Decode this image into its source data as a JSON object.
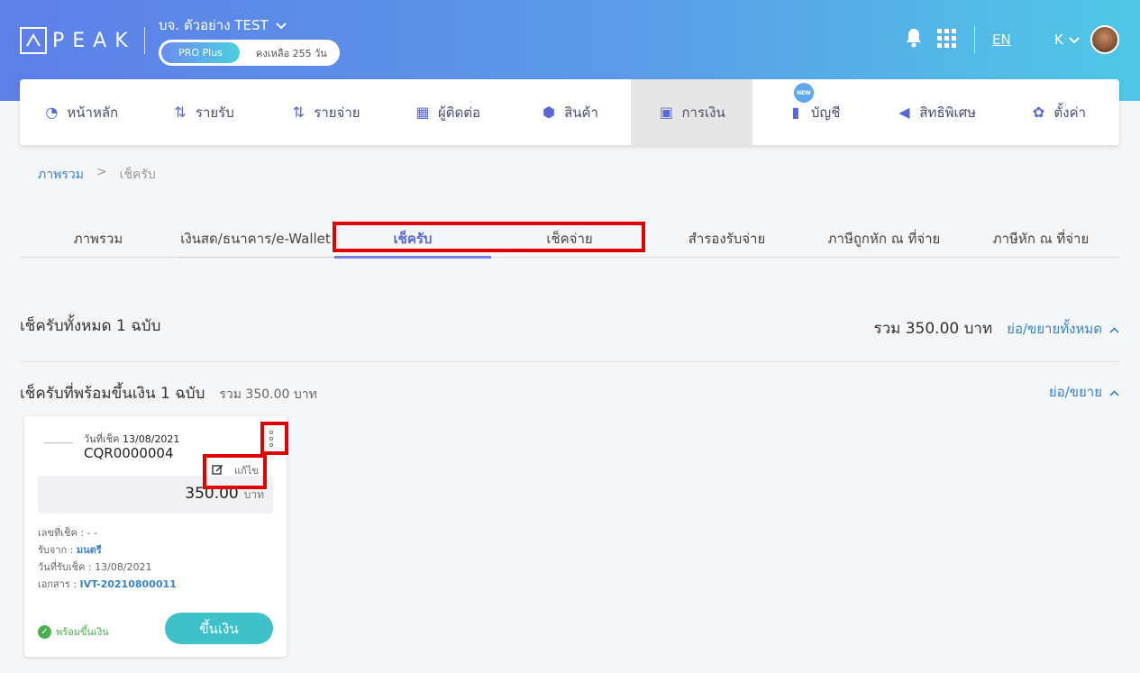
{
  "header": {
    "logo_text": "PEAK",
    "company": "บจ. ตัวอย่าง TEST",
    "plan": "PRO Plus",
    "plan_days": "คงเหลือ 255 วัน",
    "lang": "EN",
    "user_initial": "K"
  },
  "nav": [
    {
      "label": "หน้าหลัก",
      "icon": "dashboard-icon",
      "glyph": "◔"
    },
    {
      "label": "รายรับ",
      "icon": "income-icon",
      "glyph": "⇅"
    },
    {
      "label": "รายจ่าย",
      "icon": "expense-icon",
      "glyph": "⇅"
    },
    {
      "label": "ผู้ติดต่อ",
      "icon": "contacts-icon",
      "glyph": "▦"
    },
    {
      "label": "สินค้า",
      "icon": "product-box-icon",
      "glyph": "⬢"
    },
    {
      "label": "การเงิน",
      "icon": "money-icon",
      "glyph": "▣"
    },
    {
      "label": "บัญชี",
      "icon": "accounting-book-icon",
      "glyph": "▮"
    },
    {
      "label": "สิทธิพิเศษ",
      "icon": "megaphone-icon",
      "glyph": "◀"
    },
    {
      "label": "ตั้งค่า",
      "icon": "gear-icon",
      "glyph": "✿"
    }
  ],
  "nav_new_badge": "NEW",
  "breadcrumb": {
    "root": "ภาพรวม",
    "sep": ">",
    "current": "เช็ครับ"
  },
  "tabs": [
    "ภาพรวม",
    "เงินสด/ธนาคาร/e-Wallet",
    "เช็ครับ",
    "เช็คจ่าย",
    "สำรองรับจ่าย",
    "ภาษีถูกหัก ณ ที่จ่าย",
    "ภาษีหัก ณ ที่จ่าย"
  ],
  "summary": {
    "title": "เช็ครับทั้งหมด 1 ฉบับ",
    "total": "รวม 350.00 บาท",
    "toggle_all": "ย่อ/ขยายทั้งหมด"
  },
  "group": {
    "title": "เช็ครับที่พร้อมขึ้นเงิน 1 ฉบับ",
    "subtotal": "รวม 350.00 บาท",
    "toggle": "ย่อ/ขยาย"
  },
  "card": {
    "date_label": "วันที่เช็ค",
    "date": "13/08/2021",
    "number": "CQR0000004",
    "edit": "แก้ไข",
    "amount": "350.00",
    "currency": "บาท",
    "cheque_no": "เลขที่เช็ค : - -",
    "from_label": "รับจาก : ",
    "from": "มนตรี",
    "received_date": "วันที่รับเช็ค : 13/08/2021",
    "doc_label": "เอกสาร : ",
    "doc": "IVT-20210800011",
    "status": "พร้อมขึ้นเงิน",
    "cash_button": "ขึ้นเงิน"
  }
}
